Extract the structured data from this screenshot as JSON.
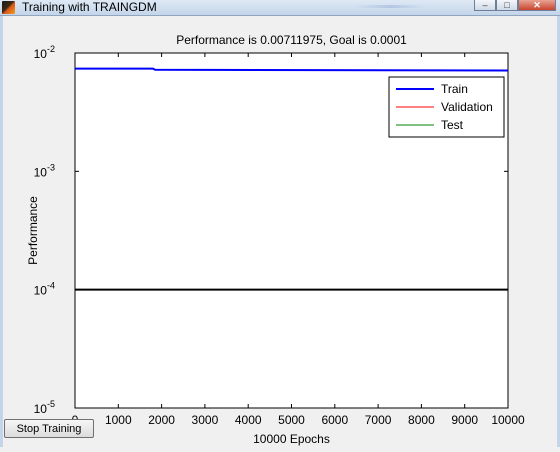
{
  "window": {
    "title": "Training with TRAINGDM",
    "controls": {
      "minimize": "–",
      "maximize": "□",
      "close": "✕"
    }
  },
  "chart_data": {
    "type": "line",
    "title": "Performance is 0.00711975, Goal is 0.0001",
    "xlabel": "10000 Epochs",
    "ylabel": "Performance",
    "xlim": [
      0,
      10000
    ],
    "ylim": [
      1e-05,
      0.01
    ],
    "yscale": "log",
    "x_ticks": [
      "0",
      "1000",
      "2000",
      "3000",
      "4000",
      "5000",
      "6000",
      "7000",
      "8000",
      "9000",
      "10000"
    ],
    "y_ticks": [
      {
        "base": "10",
        "exp": "-2"
      },
      {
        "base": "10",
        "exp": "-3"
      },
      {
        "base": "10",
        "exp": "-4"
      },
      {
        "base": "10",
        "exp": "-5"
      }
    ],
    "legend_position": "top-right",
    "series": [
      {
        "name": "Train",
        "color": "#0000ff",
        "x": [
          0,
          1800,
          1850,
          10000
        ],
        "y": [
          0.00738,
          0.00738,
          0.00722,
          0.00712
        ]
      },
      {
        "name": "Validation",
        "color": "#ff0000",
        "x": [],
        "y": []
      },
      {
        "name": "Test",
        "color": "#008000",
        "x": [],
        "y": []
      }
    ],
    "goal": {
      "value": 0.0001,
      "color": "#000000"
    }
  },
  "controls": {
    "stop_label": "Stop Training"
  }
}
